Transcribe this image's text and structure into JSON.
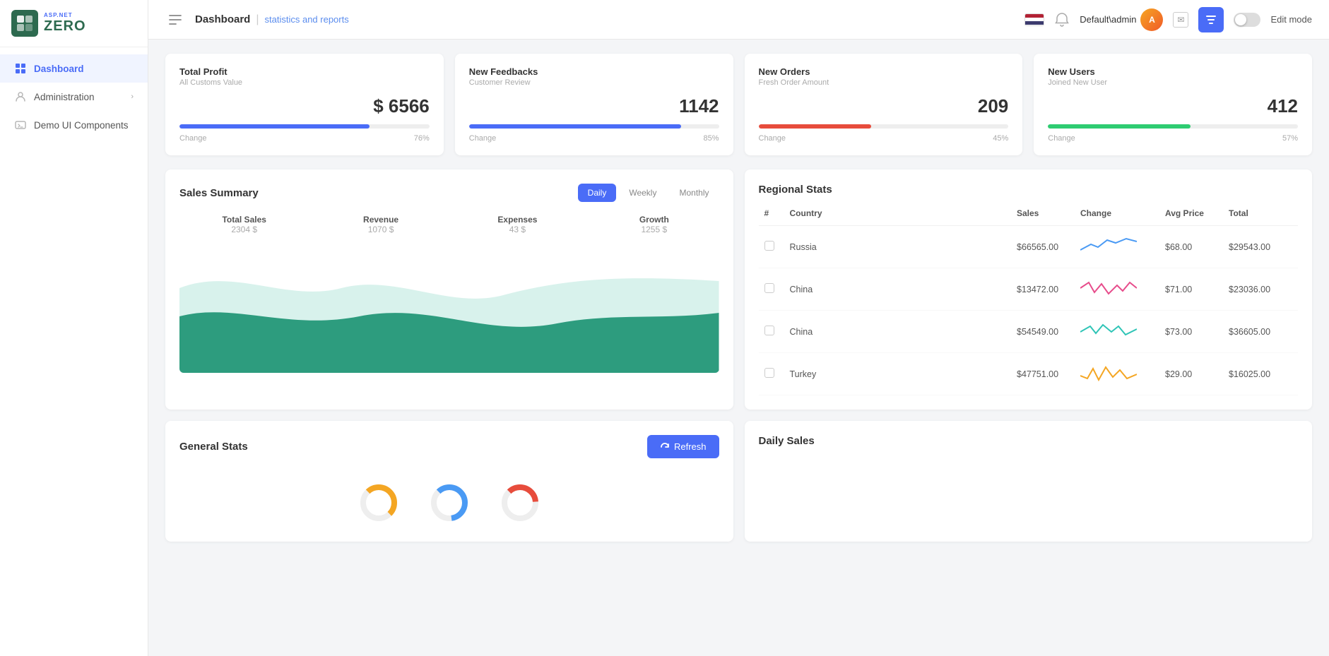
{
  "app": {
    "logo_top": "ASP.NET",
    "logo_main": "ZERO"
  },
  "sidebar": {
    "items": [
      {
        "id": "dashboard",
        "label": "Dashboard",
        "active": true,
        "has_arrow": false
      },
      {
        "id": "administration",
        "label": "Administration",
        "active": false,
        "has_arrow": true
      },
      {
        "id": "demo-ui",
        "label": "Demo UI Components",
        "active": false,
        "has_arrow": false
      }
    ]
  },
  "header": {
    "breadcrumb_main": "Dashboard",
    "breadcrumb_sub": "statistics and reports",
    "user": "Default\\admin",
    "filter_icon": "⊟",
    "edit_mode_label": "Edit mode"
  },
  "stats": [
    {
      "label": "Total Profit",
      "sublabel": "All Customs Value",
      "value": "$ 6566",
      "progress": 76,
      "progress_color": "#4a6cf7",
      "change_label": "Change",
      "change_value": "76%"
    },
    {
      "label": "New Feedbacks",
      "sublabel": "Customer Review",
      "value": "1142",
      "progress": 85,
      "progress_color": "#4a6cf7",
      "change_label": "Change",
      "change_value": "85%"
    },
    {
      "label": "New Orders",
      "sublabel": "Fresh Order Amount",
      "value": "209",
      "progress": 45,
      "progress_color": "#e74c3c",
      "change_label": "Change",
      "change_value": "45%"
    },
    {
      "label": "New Users",
      "sublabel": "Joined New User",
      "value": "412",
      "progress": 57,
      "progress_color": "#2ecc71",
      "change_label": "Change",
      "change_value": "57%"
    }
  ],
  "sales_summary": {
    "title": "Sales Summary",
    "tabs": [
      "Daily",
      "Weekly",
      "Monthly"
    ],
    "active_tab": 0,
    "stats": [
      {
        "label": "Total Sales",
        "value": "2304 $"
      },
      {
        "label": "Revenue",
        "value": "1070 $"
      },
      {
        "label": "Expenses",
        "value": "43 $"
      },
      {
        "label": "Growth",
        "value": "1255 $"
      }
    ]
  },
  "regional_stats": {
    "title": "Regional Stats",
    "columns": [
      "#",
      "Country",
      "Sales",
      "Change",
      "Avg Price",
      "Total"
    ],
    "rows": [
      {
        "country": "Russia",
        "sales": "$66565.00",
        "avg_price": "$68.00",
        "total": "$29543.00",
        "sparkline_color": "#4a9af4"
      },
      {
        "country": "China",
        "sales": "$13472.00",
        "avg_price": "$71.00",
        "total": "$23036.00",
        "sparkline_color": "#e74c8b"
      },
      {
        "country": "China",
        "sales": "$54549.00",
        "avg_price": "$73.00",
        "total": "$36605.00",
        "sparkline_color": "#2ec4b6"
      },
      {
        "country": "Turkey",
        "sales": "$47751.00",
        "avg_price": "$29.00",
        "total": "$16025.00",
        "sparkline_color": "#f4a623"
      }
    ]
  },
  "general_stats": {
    "title": "General Stats",
    "refresh_label": "Refresh"
  },
  "daily_sales": {
    "title": "Daily Sales"
  },
  "colors": {
    "primary": "#4a6cf7",
    "success": "#2ecc71",
    "danger": "#e74c3c",
    "accent1": "#2d9c7e",
    "accent1_light": "#a8ddd0"
  }
}
